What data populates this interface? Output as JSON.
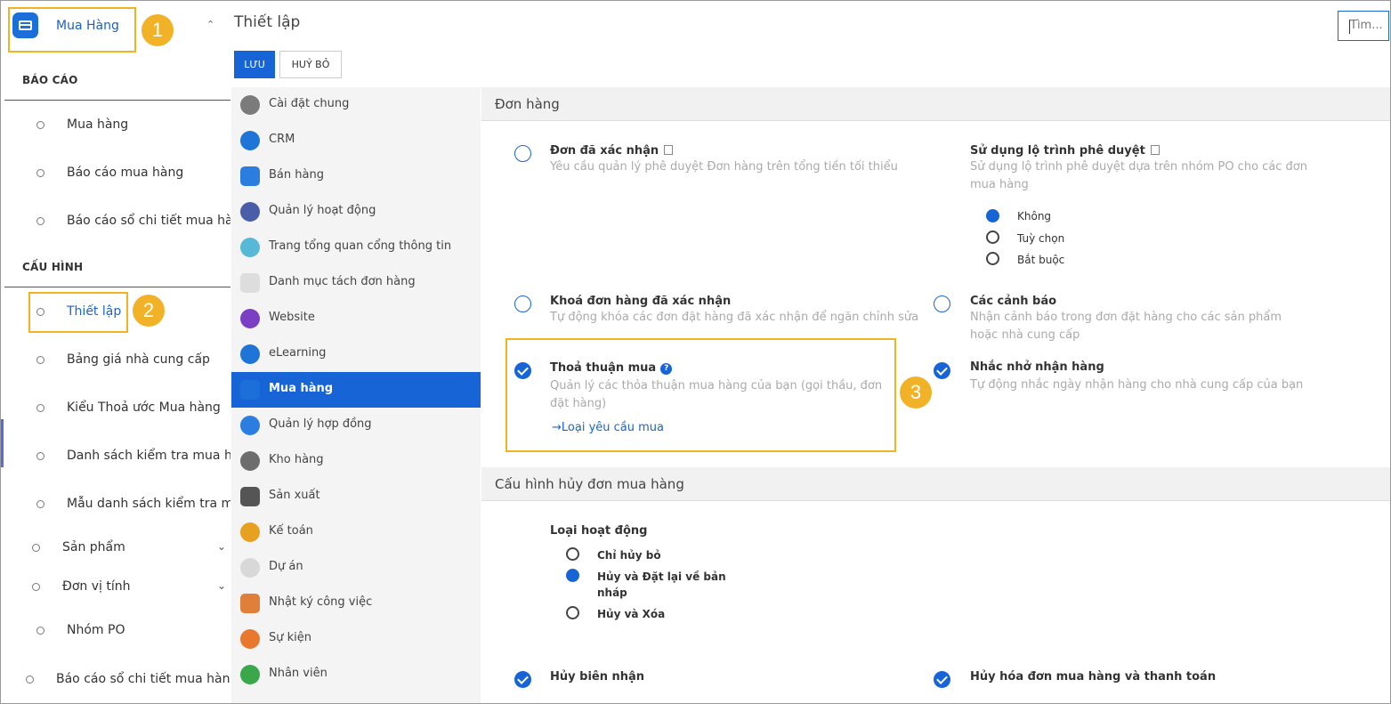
{
  "nav": {
    "module": {
      "label": "Mua Hàng",
      "icon": "purchase-card-icon"
    },
    "badges": [
      "1",
      "2",
      "3"
    ],
    "report_section": "BÁO CÁO",
    "report_items": [
      "Mua hàng",
      "Báo cáo mua hàng",
      "Báo cáo sổ chi tiết mua hàn"
    ],
    "config_section": "CẤU HÌNH",
    "config_items": [
      "Thiết lập",
      "Bảng giá nhà cung cấp",
      "Kiểu Thoả ước Mua hàng",
      "Danh sách kiểm tra mua hà",
      "Mẫu danh sách kiểm tra mu"
    ],
    "group_items": [
      "Sản phẩm",
      "Đơn vị tính"
    ],
    "po_group": "Nhóm PO",
    "last_item": "Báo cáo sổ chi tiết mua hàn"
  },
  "header": {
    "title": "Thiết lập",
    "save": "LƯU",
    "cancel": "HUỶ BỎ",
    "search_placeholder": "Tìm..."
  },
  "menu": [
    {
      "label": "Cài đặt chung",
      "icon": "gear-icon",
      "color": "#7b7b7b"
    },
    {
      "label": "CRM",
      "icon": "handshake-icon",
      "color": "#1f74d8"
    },
    {
      "label": "Bán hàng",
      "icon": "chart-up-icon",
      "color": "#2b7ee0"
    },
    {
      "label": "Quản lý hoạt động",
      "icon": "clock-icon",
      "color": "#4a5da8"
    },
    {
      "label": "Trang tổng quan cổng thông tin",
      "icon": "portal-icon",
      "color": "#58b8d8"
    },
    {
      "label": "Danh mục tách đơn hàng",
      "icon": "split-icon",
      "color": "#dddddd"
    },
    {
      "label": "Website",
      "icon": "website-icon",
      "color": "#7b3fc4"
    },
    {
      "label": "eLearning",
      "icon": "elearning-icon",
      "color": "#1f74d8"
    },
    {
      "label": "Mua hàng",
      "icon": "purchase-icon",
      "color": "#1c6fd8"
    },
    {
      "label": "Quản lý hợp đồng",
      "icon": "contract-icon",
      "color": "#2b7ee0"
    },
    {
      "label": "Kho hàng",
      "icon": "box-icon",
      "color": "#6d6d6d"
    },
    {
      "label": "Sản xuất",
      "icon": "factory-icon",
      "color": "#555555"
    },
    {
      "label": "Kế toán",
      "icon": "accounting-icon",
      "color": "#e8a020"
    },
    {
      "label": "Dự án",
      "icon": "project-icon",
      "color": "#d8d8d8"
    },
    {
      "label": "Nhật ký công việc",
      "icon": "worklog-icon",
      "color": "#e07f3a"
    },
    {
      "label": "Sự kiện",
      "icon": "event-icon",
      "color": "#e8782e"
    },
    {
      "label": "Nhân viên",
      "icon": "employee-icon",
      "color": "#3aa84a"
    }
  ],
  "orders": {
    "section": "Đơn hàng",
    "confirmed": {
      "title": "Đơn đã xác nhận",
      "desc": "Yêu cầu quản lý phê duyệt Đơn hàng trên tổng tiền tối thiểu"
    },
    "approval_route": {
      "title": "Sử dụng lộ trình phê duyệt",
      "desc": "Sử dụng lộ trình phê duyệt dựa trên nhóm PO cho các đơn mua hàng",
      "options": [
        "Không",
        "Tuỳ chọn",
        "Bắt buộc"
      ]
    },
    "lock": {
      "title": "Khoá đơn hàng đã xác nhận",
      "desc": "Tự động khóa các đơn đặt hàng đã xác nhận để ngăn chỉnh sửa"
    },
    "warnings": {
      "title": "Các cảnh báo",
      "desc": "Nhận cảnh báo trong đơn đặt hàng cho các sản phẩm hoặc nhà cung cấp"
    },
    "agreement": {
      "title": "Thoả thuận mua",
      "desc": "Quản lý các thỏa thuận mua hàng của bạn (gọi thầu, đơn đặt hàng)",
      "link": "Loại yêu cầu mua"
    },
    "reminder": {
      "title": "Nhắc nhở nhận hàng",
      "desc": "Tự động nhắc ngày nhận hàng cho nhà cung cấp của bạn"
    }
  },
  "cancel_config": {
    "section": "Cấu hình hủy đơn mua hàng",
    "activity_type": "Loại hoạt động",
    "options": [
      "Chỉ hủy bỏ",
      "Hủy và Đặt lại về bản",
      "nháp",
      "Hủy và Xóa"
    ],
    "cancel_receipt": "Hủy biên nhận",
    "cancel_invoice": "Hủy hóa đơn mua hàng và thanh toán"
  }
}
